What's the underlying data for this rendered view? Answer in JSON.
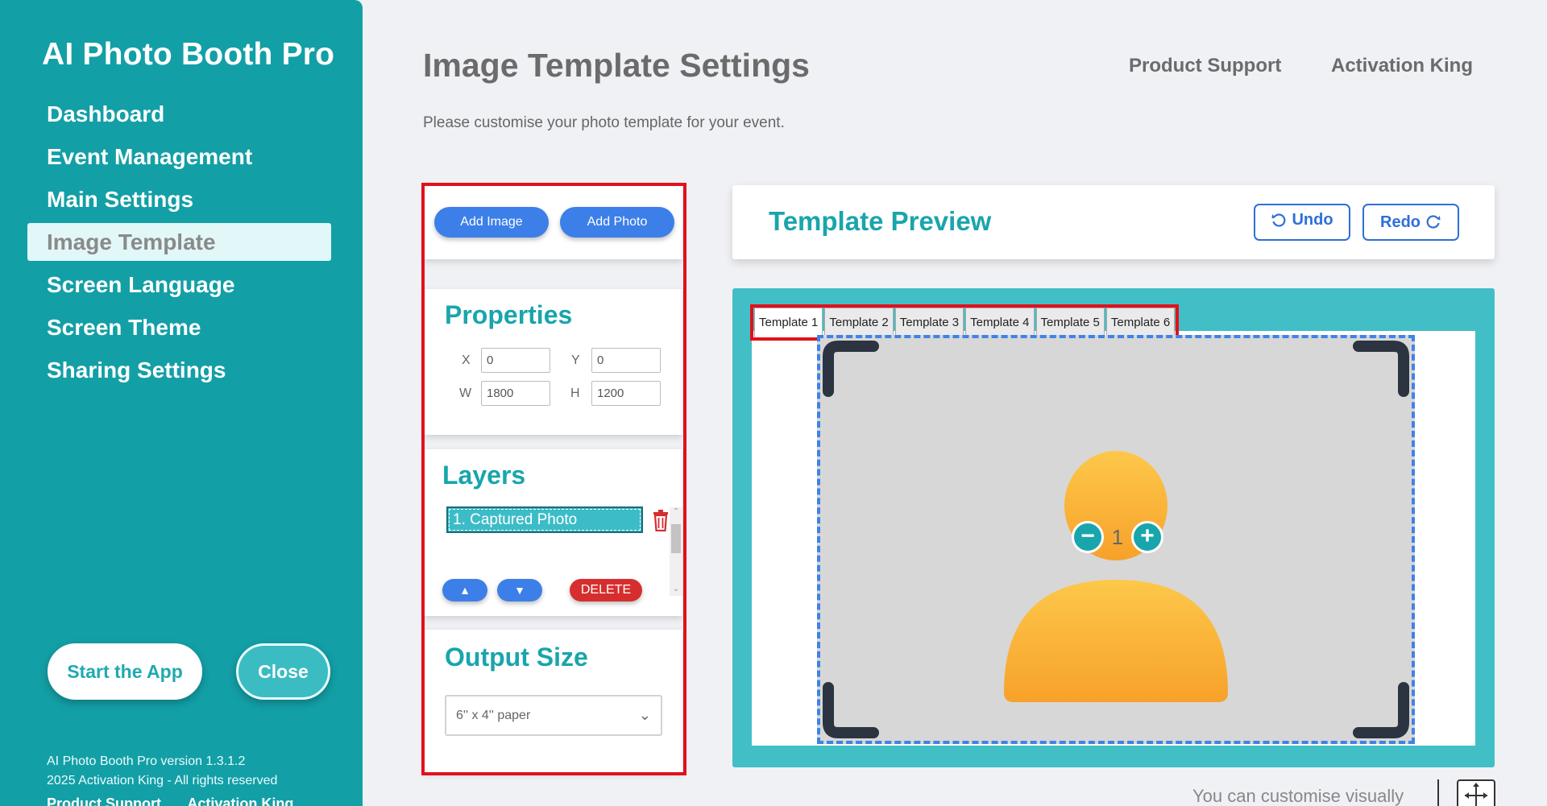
{
  "sidebar": {
    "app_title": "AI Photo Booth Pro",
    "nav": [
      {
        "label": "Dashboard",
        "active": false
      },
      {
        "label": "Event Management",
        "active": false
      },
      {
        "label": "Main Settings",
        "active": false
      },
      {
        "label": "Image Template",
        "active": true
      },
      {
        "label": "Screen Language",
        "active": false
      },
      {
        "label": "Screen Theme",
        "active": false
      },
      {
        "label": "Sharing Settings",
        "active": false
      }
    ],
    "start_label": "Start the App",
    "close_label": "Close",
    "version": "AI Photo Booth Pro version 1.3.1.2",
    "copyright": "2025 Activation King - All rights reserved",
    "footer_links": [
      "Product Support",
      "Activation King"
    ]
  },
  "header": {
    "title": "Image Template Settings",
    "subtitle": "Please customise your photo template for your event.",
    "links": [
      "Product Support",
      "Activation King"
    ]
  },
  "toolbar": {
    "add_image": "Add Image",
    "add_photo": "Add Photo"
  },
  "properties": {
    "title": "Properties",
    "x_label": "X",
    "x_value": "0",
    "y_label": "Y",
    "y_value": "0",
    "w_label": "W",
    "w_value": "1800",
    "h_label": "H",
    "h_value": "1200"
  },
  "layers": {
    "title": "Layers",
    "items": [
      "1. Captured Photo"
    ],
    "up_icon": "▲",
    "down_icon": "▼",
    "delete_label": "DELETE"
  },
  "output": {
    "title": "Output Size",
    "selected": "6'' x 4'' paper",
    "chevron": "⌄"
  },
  "preview": {
    "title": "Template Preview",
    "undo_label": "Undo",
    "redo_label": "Redo",
    "tabs": [
      {
        "label": "Template 1",
        "active": true
      },
      {
        "label": "Template 2",
        "active": false
      },
      {
        "label": "Template 3",
        "active": false
      },
      {
        "label": "Template 4",
        "active": false
      },
      {
        "label": "Template 5",
        "active": false
      },
      {
        "label": "Template 6",
        "active": false
      }
    ],
    "zoom_minus": "−",
    "zoom_value": "1",
    "zoom_plus": "+",
    "hint": "You can customise visually"
  },
  "colors": {
    "sidebar": "#139fa6",
    "accent": "#19a5ac",
    "primary_button": "#3c7fe8",
    "danger": "#d62e2e",
    "highlight_outline": "#e3101b"
  }
}
